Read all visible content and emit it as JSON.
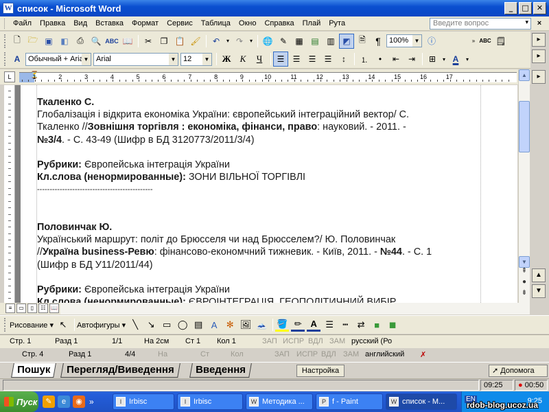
{
  "window": {
    "title": "список - Microsoft Word",
    "app_icon": "W"
  },
  "menu": {
    "items": [
      "Файл",
      "Правка",
      "Вид",
      "Вставка",
      "Формат",
      "Сервис",
      "Таблица",
      "Окно",
      "Справка",
      "Плай",
      "Рута"
    ],
    "help_placeholder": "Введите вопрос"
  },
  "toolbar": {
    "zoom": "100%"
  },
  "formatting": {
    "style": "Обычный + Aria",
    "font": "Arial",
    "size": "12",
    "bold": "Ж",
    "italic": "К",
    "underline": "Ч"
  },
  "ruler": {
    "numbers": [
      "1",
      "2",
      "1",
      "2",
      "3",
      "4",
      "5",
      "6",
      "7",
      "8",
      "9",
      "10",
      "11",
      "12",
      "13",
      "14",
      "15",
      "16",
      "17"
    ]
  },
  "document": {
    "entry1": {
      "author": "Ткаленко С.",
      "line1": "Глобалізація і відкрита економіка України: європейський інтеграційний вектор/ С.",
      "line2a": "Ткаленко //",
      "line2b": "Зовнішня торгівля : економіка, фінанси, право",
      "line2c": ": науковий. - 2011. -",
      "line3a": "№3/4",
      "line3b": ". -  С. 43-49 (Шифр в БД 3120773/2011/3/4)",
      "rubric_label": "Рубрики:",
      "rubric_value": " Європейська інтеграція України",
      "keywords_label": "Кл.слова (ненормированные):",
      "keywords_value": " ЗОНИ ВІЛЬНОЇ ТОРГІВЛІ",
      "separator": "----------------------------------------------"
    },
    "entry2": {
      "author": "Половинчак Ю.",
      "line1": "Український маршрут: політ до Брюсселя чи над Брюсселем?/ Ю. Половинчак",
      "line2a": "//",
      "line2b": "Україна business-Ревю",
      "line2c": ": фінансово-економчний тижневик. - Київ, 2011. - ",
      "line2d": "№44",
      "line2e": ". -  С. 1",
      "line3": "(Шифр в БД У11/2011/44)",
      "rubric_label": "Рубрики:",
      "rubric_value": " Європейська інтеграція України",
      "keywords_label": "Кл.слова (ненормированные):",
      "keywords_value": " ЄВРОІНТЕГРАЦІЯ, ГЕОПОЛІТИЧНИЙ ВИБІР"
    }
  },
  "drawing": {
    "draw_label": "Рисование ▾",
    "autoshapes_label": "Автофигуры ▾"
  },
  "status1": {
    "page": "Стр.  1",
    "section": "Разд  1",
    "pages": "1/1",
    "at": "На  2см",
    "line": "Ст  1",
    "col": "Кол  1",
    "rec": "ЗАП",
    "trk": "ИСПР",
    "ext": "ВДЛ",
    "ovr": "ЗАМ",
    "lang": "русский (Ро"
  },
  "status2": {
    "page": "Стр.  4",
    "section": "Разд  1",
    "pages": "4/4",
    "at": "На",
    "line": "Ст",
    "col": "Кол",
    "rec": "ЗАП",
    "trk": "ИСПР",
    "ext": "ВДЛ",
    "ovr": "ЗАМ",
    "lang": "английский"
  },
  "tabs": [
    "Пошук",
    "Перегляд/Виведення",
    "Введення"
  ],
  "buttons": {
    "settings": "Настройка",
    "help": "Допомога"
  },
  "time": {
    "t1": "09:25",
    "t2": "00:50"
  },
  "taskbar": {
    "start": "Пуск",
    "tasks": [
      "Irbisc",
      "Irbisc",
      "Методика ...",
      "f - Paint",
      "список - М..."
    ],
    "lang": "EN",
    "clock": "9:25"
  },
  "watermark": "rdob-blog.ucoz.ua"
}
